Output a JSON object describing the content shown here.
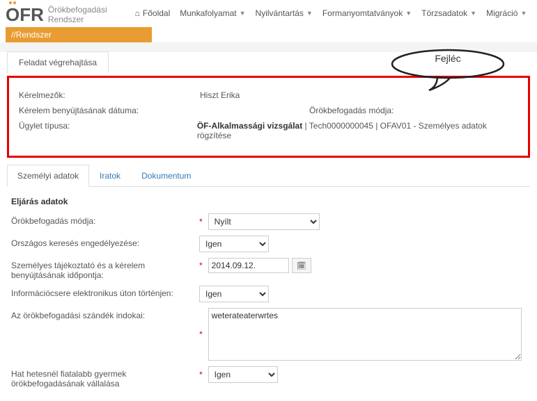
{
  "logo": {
    "text": "ÖFR",
    "sub1": "Örökbefogadási",
    "sub2": "Rendszer"
  },
  "nav": {
    "home": "Főoldal",
    "workflow": "Munkafolyamat",
    "registry": "Nyilvántartás",
    "forms": "Formanyomtatványok",
    "masterdata": "Törzsadatok",
    "migration": "Migráció"
  },
  "orangebar": "//Rendszer",
  "task_tab": "Feladat végrehajtása",
  "annotation": "Fejléc",
  "header": {
    "applicants_label": "Kérelmezők:",
    "applicants_value": "Hiszt Erika",
    "submitdate_label": "Kérelem benyújtásának dátuma:",
    "adoptmode_label": "Örökbefogadás módja:",
    "casetype_label": "Ügylet típusa:",
    "casetype_strong": "ÖF-Alkalmassági vizsgálat",
    "casetype_rest": " | Tech0000000045 | OFAV01 - Személyes adatok rögzítése"
  },
  "tabs": {
    "personal": "Személyi adatok",
    "docs": "Iratok",
    "document": "Dokumentum"
  },
  "form": {
    "section_title": "Eljárás adatok",
    "adopt_mode_label": "Örökbefogadás módja:",
    "adopt_mode_value": "Nyílt",
    "national_search_label": "Országos keresés engedélyezése:",
    "national_search_value": "Igen",
    "personal_info_label": "Személyes tájékoztató és a kérelem benyújtásának időpontja:",
    "personal_info_value": "2014.09.12.",
    "einfo_label": "Információcsere elektronikus úton történjen:",
    "einfo_value": "Igen",
    "reasons_label": "Az örökbefogadási szándék indokai:",
    "reasons_value": "weterateaterwrtes",
    "sixweeks_label": "Hat hetesnél fiatalabb gyermek örökbefogadásának vállalása",
    "sixweeks_value": "Igen"
  }
}
